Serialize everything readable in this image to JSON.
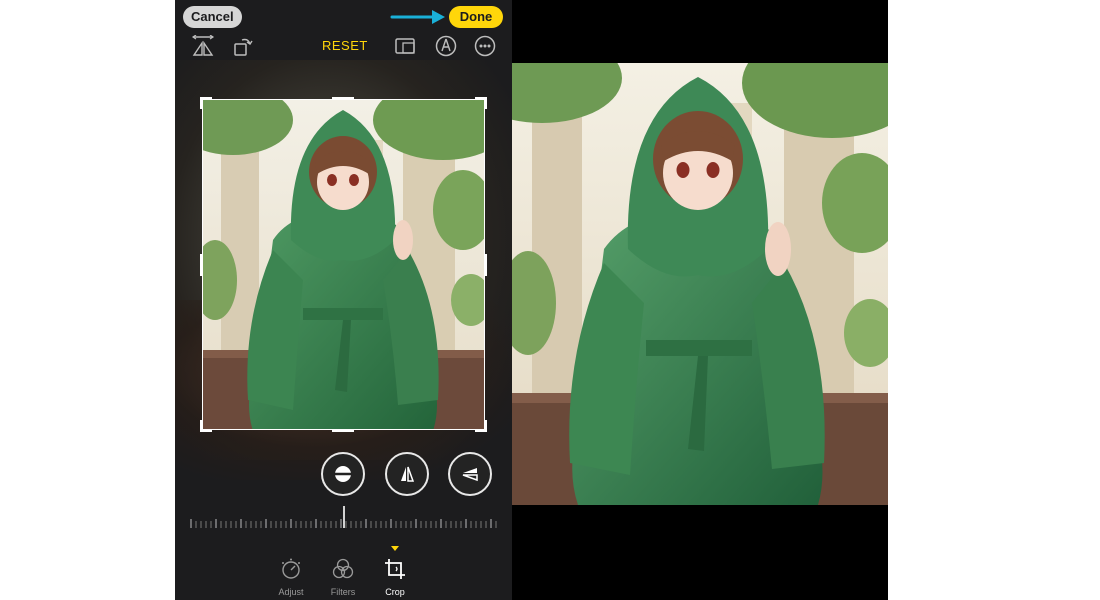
{
  "toolbar": {
    "cancel_label": "Cancel",
    "done_label": "Done",
    "reset_label": "RESET"
  },
  "tabs": [
    {
      "label": "Adjust",
      "icon": "adjust-dial-icon",
      "active": false
    },
    {
      "label": "Filters",
      "icon": "filters-circles-icon",
      "active": false
    },
    {
      "label": "Crop",
      "icon": "crop-icon",
      "active": true
    }
  ],
  "top_icons": [
    "flip-icon",
    "rotate-icon",
    "aspect-ratio-icon",
    "markup-pen-icon",
    "more-icon"
  ],
  "perspective_icons": [
    "straighten-icon",
    "vertical-perspective-icon",
    "horizontal-perspective-icon"
  ],
  "colors": {
    "accent": "#ffd60a",
    "annotation_arrow": "#1ab0d8",
    "panel_bg": "#1c1c1e",
    "result_bg": "#000000"
  }
}
